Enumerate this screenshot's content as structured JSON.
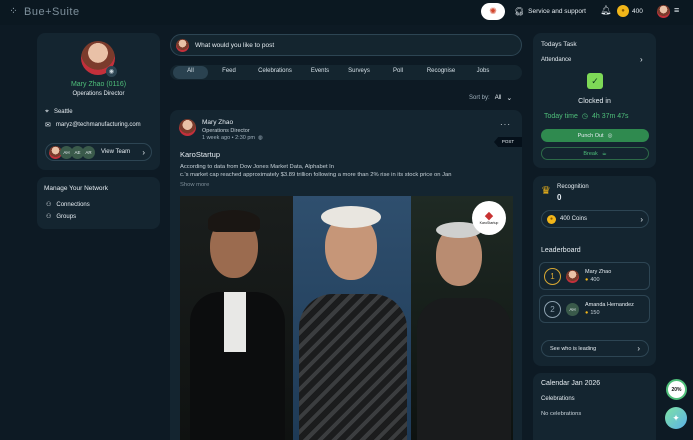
{
  "app": {
    "brand": "Bue+Suite"
  },
  "topbar": {
    "support_label": "Service and support",
    "coins": "400"
  },
  "profile": {
    "name": "Mary Zhao (0116)",
    "title": "Operations Director",
    "location": "Seattle",
    "email": "maryz@techmanufacturing.com",
    "team_initials": [
      "AH",
      "AE",
      "AR"
    ],
    "view_team_label": "View Team"
  },
  "network": {
    "title": "Manage Your Network",
    "items": [
      "Connections",
      "Groups"
    ]
  },
  "composer": {
    "placeholder": "What would you like to post"
  },
  "filters": [
    "All",
    "Feed",
    "Celebrations",
    "Events",
    "Surveys",
    "Poll",
    "Recognise",
    "Jobs"
  ],
  "sort": {
    "label": "Sort by:",
    "value": "All"
  },
  "post": {
    "author": "Mary Zhao",
    "author_title": "Operations Director",
    "time": "1 week ago • 2:30 pm",
    "tag": "POST",
    "headline": "KaroStartup",
    "text_line1": "According to data from Dow Jones Market Data, Alphabet In",
    "text_line2": "c.'s market cap reached approximately $3.89 trillion following a more than 2% rise in its stock price on Jan",
    "show_more": "Show more",
    "logo_text": "KaroStartup"
  },
  "task": {
    "title": "Todays Task",
    "attendance_label": "Attendance",
    "status": "Clocked in",
    "today_label": "Today time",
    "today_value": "4h 37m 47s",
    "punch_out_label": "Punch Out",
    "break_label": "Break"
  },
  "recognition": {
    "label": "Recognition",
    "count": "0",
    "coins_label": "400 Coins"
  },
  "leaderboard": {
    "title": "Leaderboard",
    "entries": [
      {
        "rank": "1",
        "name": "Mary Zhao",
        "points": "400"
      },
      {
        "rank": "2",
        "name": "Amanda Hernandez",
        "initials": "AH",
        "points": "150"
      }
    ],
    "see_leading_label": "See who is leading"
  },
  "calendar": {
    "title": "Calendar Jan 2026",
    "celebrations_label": "Celebrations",
    "empty_label": "No celebrations"
  },
  "progress": {
    "value": "20%"
  }
}
